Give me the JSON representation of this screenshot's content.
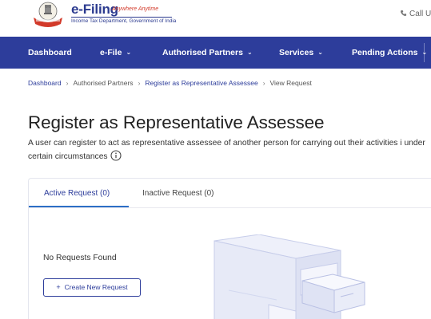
{
  "header": {
    "logo_title": "e-Filing",
    "logo_tagline": "Anywhere Anytime",
    "logo_subtitle": "Income Tax Department, Government of India",
    "call_us": "Call U"
  },
  "nav": {
    "items": [
      {
        "label": "Dashboard",
        "has_dropdown": false
      },
      {
        "label": "e-File",
        "has_dropdown": true
      },
      {
        "label": "Authorised Partners",
        "has_dropdown": true
      },
      {
        "label": "Services",
        "has_dropdown": true
      },
      {
        "label": "Pending Actions",
        "has_dropdown": true
      }
    ]
  },
  "breadcrumb": [
    {
      "label": "Dashboard",
      "link": true
    },
    {
      "label": "Authorised Partners",
      "link": false
    },
    {
      "label": "Register as Representative Assessee",
      "link": true
    },
    {
      "label": "View Request",
      "link": false
    }
  ],
  "page": {
    "title": "Register as Representative Assessee",
    "description": "A user can register to act as representative assessee of another person for carrying out their activities i under certain circumstances"
  },
  "tabs": [
    {
      "label": "Active Request (0)",
      "active": true
    },
    {
      "label": "Inactive Request (0)",
      "active": false
    }
  ],
  "content": {
    "empty_message": "No Requests Found",
    "create_button": "Create New Request"
  },
  "colors": {
    "nav_bg": "#2d3d9b",
    "accent": "#2d6fc6",
    "brand_red": "#d23a2a"
  },
  "icons": {
    "emblem": "emblem-icon",
    "phone": "phone-icon",
    "info": "info-icon",
    "plus": "plus-icon",
    "chevron": "chevron-down-icon"
  }
}
